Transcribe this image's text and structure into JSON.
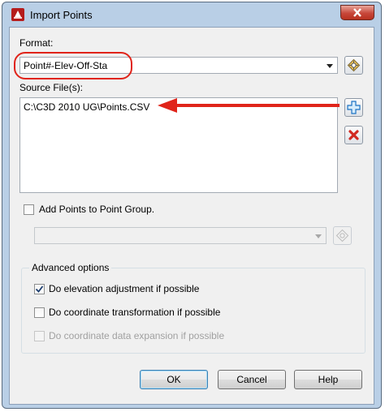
{
  "window": {
    "title": "Import Points"
  },
  "format": {
    "label": "Format:",
    "value": "Point#-Elev-Off-Sta"
  },
  "source": {
    "label": "Source File(s):",
    "files": [
      "C:\\C3D 2010 UG\\Points.CSV"
    ]
  },
  "point_group": {
    "label": "Add Points to Point Group.",
    "checked": false,
    "value": ""
  },
  "advanced": {
    "label": "Advanced options",
    "options": [
      {
        "label": "Do elevation adjustment if possible",
        "checked": true,
        "enabled": true
      },
      {
        "label": "Do coordinate transformation if possible",
        "checked": false,
        "enabled": true
      },
      {
        "label": "Do coordinate data expansion if possible",
        "checked": false,
        "enabled": false
      }
    ]
  },
  "buttons": {
    "ok": "OK",
    "cancel": "Cancel",
    "help": "Help"
  },
  "colors": {
    "annotation": "#e0241a",
    "dialog_bg": "#f0f0f0",
    "frame": "#b9cfe6"
  }
}
